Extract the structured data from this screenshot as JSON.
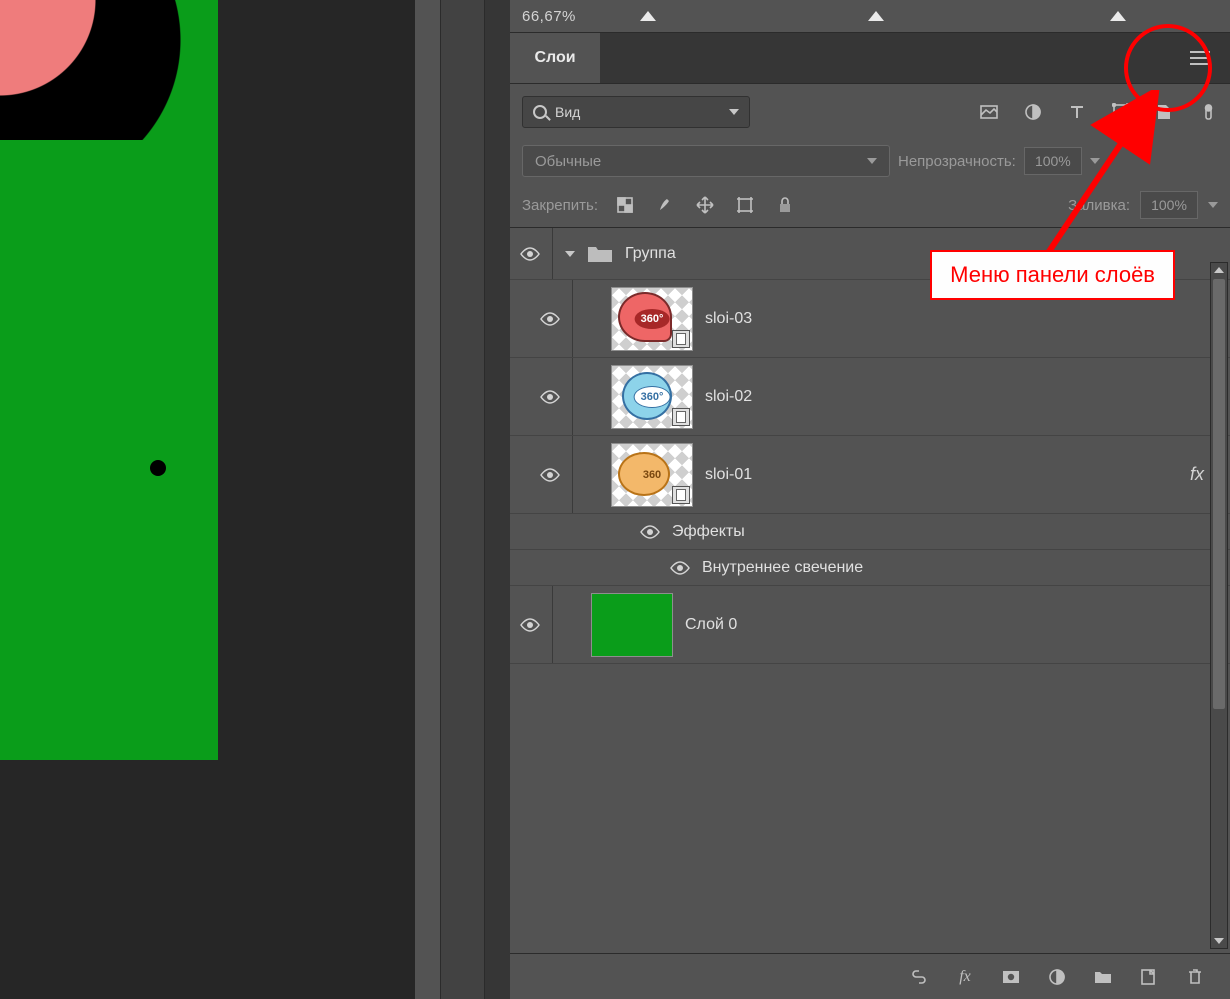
{
  "zoom": "66,67%",
  "panel": {
    "tab_label": "Слои",
    "search_label": "Вид",
    "blend_mode": "Обычные",
    "opacity_label": "Непрозрачность:",
    "opacity_value": "100%",
    "lock_label": "Закрепить:",
    "fill_label": "Заливка:",
    "fill_value": "100%"
  },
  "layers": {
    "group_name": "Группа",
    "items": [
      {
        "name": "sloi-03"
      },
      {
        "name": "sloi-02"
      },
      {
        "name": "sloi-01"
      }
    ],
    "effects_label": "Эффекты",
    "effect1": "Внутреннее свечение",
    "base_layer": "Слой 0",
    "fx_label": "fx"
  },
  "annotation": {
    "label": "Меню панели слоёв"
  }
}
